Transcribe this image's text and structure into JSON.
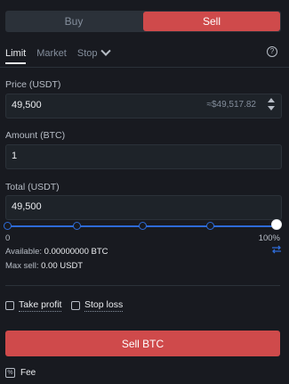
{
  "side_tabs": {
    "buy": "Buy",
    "sell": "Sell"
  },
  "order_types": {
    "limit": "Limit",
    "market": "Market",
    "stop": "Stop"
  },
  "price": {
    "label": "Price (USDT)",
    "value": "49,500",
    "approx": "≈$49,517.82"
  },
  "amount": {
    "label": "Amount (BTC)",
    "value": "1"
  },
  "total": {
    "label": "Total (USDT)",
    "value": "49,500"
  },
  "slider": {
    "min_label": "0",
    "max_label": "100%",
    "value_percent": 100
  },
  "available": {
    "label": "Available:",
    "value": "0.00000000 BTC"
  },
  "max_sell": {
    "label": "Max sell:",
    "value": "0.00 USDT"
  },
  "options": {
    "take_profit": "Take profit",
    "stop_loss": "Stop loss"
  },
  "submit": {
    "label": "Sell BTC"
  },
  "fee": {
    "label": "Fee"
  },
  "colors": {
    "sell": "#cf4a4b",
    "accent_blue": "#2e6bd7",
    "background": "#181a20"
  }
}
